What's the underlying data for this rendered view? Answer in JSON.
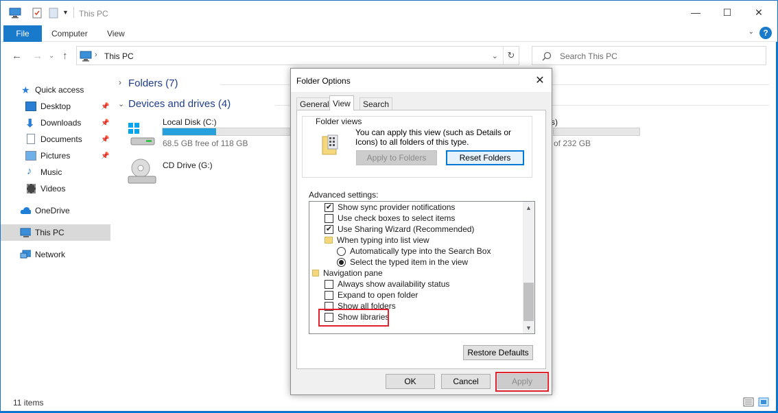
{
  "window": {
    "title": "This PC",
    "minimize": "—",
    "maximize": "☐",
    "close": "✕"
  },
  "ribbon": {
    "tabs": [
      "File",
      "Computer",
      "View"
    ],
    "help": "?"
  },
  "address": {
    "path": "This PC",
    "search_placeholder": "Search This PC"
  },
  "sidebar": {
    "items": [
      {
        "label": "Quick access",
        "icon": "star-icon",
        "pinned": false
      },
      {
        "label": "Desktop",
        "icon": "desktop-icon",
        "pinned": true
      },
      {
        "label": "Downloads",
        "icon": "download-icon",
        "pinned": true
      },
      {
        "label": "Documents",
        "icon": "documents-icon",
        "pinned": true
      },
      {
        "label": "Pictures",
        "icon": "pictures-icon",
        "pinned": true
      },
      {
        "label": "Music",
        "icon": "music-icon",
        "pinned": false
      },
      {
        "label": "Videos",
        "icon": "videos-icon",
        "pinned": false
      },
      {
        "label": "OneDrive",
        "icon": "cloud-icon",
        "pinned": false
      },
      {
        "label": "This PC",
        "icon": "computer-icon",
        "pinned": false,
        "selected": true
      },
      {
        "label": "Network",
        "icon": "network-icon",
        "pinned": false
      }
    ]
  },
  "content": {
    "folders_header": "Folders (7)",
    "devices_header": "Devices and drives (4)",
    "drives": [
      {
        "name": "Local Disk (C:)",
        "free": "68.5 GB free of 118 GB",
        "used_fraction": 0.42
      },
      {
        "name": "CD Drive (G:)",
        "free": ""
      }
    ],
    "hidden_drive_suffix": "s)",
    "hidden_drive_free": "of 232 GB"
  },
  "status": {
    "items": "11 items"
  },
  "dialog": {
    "title": "Folder Options",
    "tabs": [
      "General",
      "View",
      "Search"
    ],
    "active_tab": "View",
    "folder_views_label": "Folder views",
    "folder_views_text": "You can apply this view (such as Details or Icons) to all folders of this type.",
    "apply_to_folders": "Apply to Folders",
    "reset_folders": "Reset Folders",
    "advanced_label": "Advanced settings:",
    "settings": [
      {
        "type": "checkbox",
        "label": "Show sync provider notifications",
        "checked": true,
        "indent": 1
      },
      {
        "type": "checkbox",
        "label": "Use check boxes to select items",
        "checked": false,
        "indent": 1
      },
      {
        "type": "checkbox",
        "label": "Use Sharing Wizard (Recommended)",
        "checked": true,
        "indent": 1
      },
      {
        "type": "folder",
        "label": "When typing into list view",
        "indent": 1
      },
      {
        "type": "radio",
        "label": "Automatically type into the Search Box",
        "checked": false,
        "indent": 2
      },
      {
        "type": "radio",
        "label": "Select the typed item in the view",
        "checked": true,
        "indent": 2
      },
      {
        "type": "folder",
        "label": "Navigation pane",
        "indent": 0
      },
      {
        "type": "checkbox",
        "label": "Always show availability status",
        "checked": false,
        "indent": 1
      },
      {
        "type": "checkbox",
        "label": "Expand to open folder",
        "checked": false,
        "indent": 1
      },
      {
        "type": "checkbox",
        "label": "Show all folders",
        "checked": false,
        "indent": 1
      },
      {
        "type": "checkbox",
        "label": "Show libraries",
        "checked": false,
        "indent": 1
      }
    ],
    "restore_defaults": "Restore Defaults",
    "ok": "OK",
    "cancel": "Cancel",
    "apply": "Apply"
  },
  "colors": {
    "accent": "#0078d7",
    "highlight": "#e0202a",
    "drive_fill": "#26a0da"
  }
}
